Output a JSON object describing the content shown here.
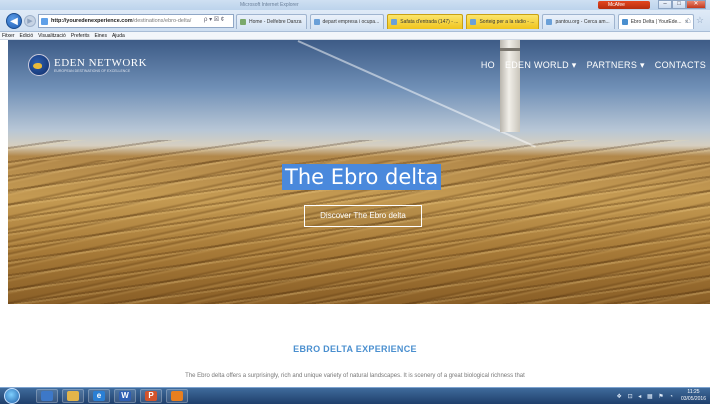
{
  "window": {
    "title": "Microsoft Internet Explorer",
    "mcafee": "McAfee",
    "minimize": "–",
    "maximize": "□",
    "close": "✕"
  },
  "address_bar": {
    "host": "http://youredenexperience.com",
    "path": "/destinations/ebro-delta/",
    "tools": "ρ ▾ ☒ ¢"
  },
  "tabs": [
    {
      "label": "Home - Delfebre Danza",
      "color": "#7aa86a",
      "style": ""
    },
    {
      "label": "depart empresa i ocupa...",
      "color": "#6aa0d8",
      "style": ""
    },
    {
      "label": "Safata d'entrada (147) - ...",
      "color": "#6aa0d8",
      "style": "yellow"
    },
    {
      "label": "Sorteig per a la ràdio - ...",
      "color": "#6aa0d8",
      "style": "yellow"
    },
    {
      "label": "pantou.org - Cerca am...",
      "color": "#6aa0d8",
      "style": ""
    },
    {
      "label": "Ebro Delta | YourEde...",
      "color": "#4a8fcf",
      "style": "active",
      "close": "✕"
    }
  ],
  "menu": [
    "Fitxer",
    "Edició",
    "Visualització",
    "Preferits",
    "Eines",
    "Ajuda"
  ],
  "site": {
    "logo_name": "EDEN NETWORK",
    "logo_tag": "EUROPEAN DESTINATIONS OF EXCELLENCE",
    "nav": [
      "HO",
      "EDEN WORLD ▾",
      "PARTNERS ▾",
      "CONTACTS"
    ],
    "hero_title": "The Ebro delta",
    "hero_button": "Discover The Ebro delta",
    "section_title": "EBRO DELTA EXPERIENCE",
    "section_text": "The Ebro delta offers a surprisingly, rich and unique variety of natural landscapes. It is scenery of a great biological richness that"
  },
  "taskbar": {
    "apps": [
      {
        "label": "",
        "color": "#3d78c8"
      },
      {
        "label": "",
        "color": "#e3b54a"
      },
      {
        "label": "e",
        "color": "#2a7fd4"
      },
      {
        "label": "W",
        "color": "#2f5fb3"
      },
      {
        "label": "P",
        "color": "#d2532b"
      },
      {
        "label": "",
        "color": "#e87f1f"
      }
    ],
    "tray": "❖ ⊡ ◂ ▦ ⚑ ◔",
    "time": "11:25",
    "date": "03/05/2016"
  },
  "colors": {
    "accent": "#4a8fcf",
    "title_highlight": "#4a89dc"
  }
}
